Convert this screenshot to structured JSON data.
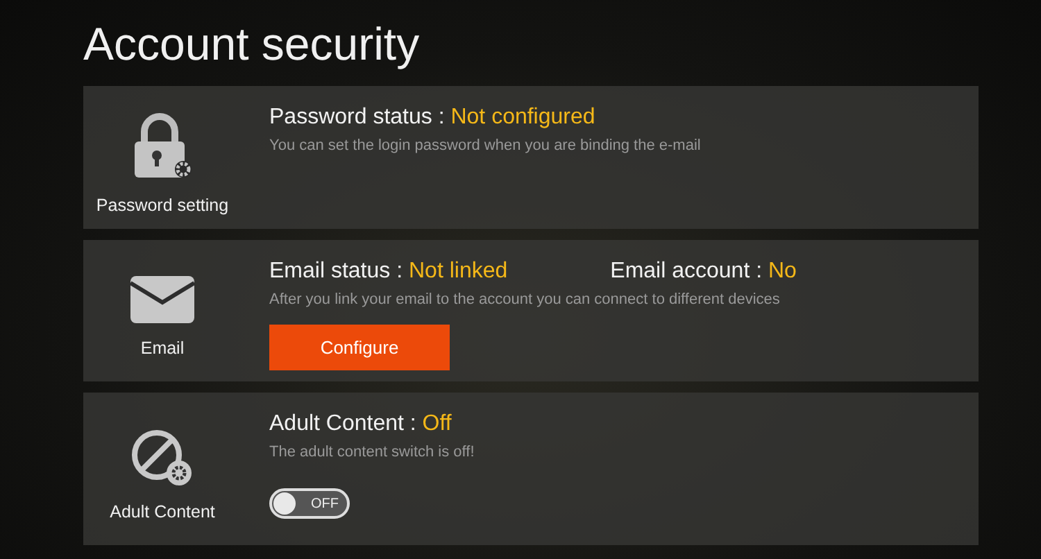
{
  "title": "Account security",
  "sections": [
    {
      "kind": "password",
      "icon_label": "Password setting",
      "status_label": "Password status :",
      "status_value": "Not configured",
      "description": "You can set the login password when you are binding the e-mail"
    },
    {
      "kind": "email",
      "icon_label": "Email",
      "status_label": "Email status :",
      "status_value": "Not linked",
      "account_label": "Email account :",
      "account_value": "No",
      "description": "After you link your email to the account you can connect to different devices",
      "button": "Configure"
    },
    {
      "kind": "adult",
      "icon_label": "Adult Content",
      "status_label": "Adult Content :",
      "status_value": "Off",
      "description": "The adult content switch is off!",
      "toggle": {
        "on": false,
        "label": "OFF"
      }
    }
  ]
}
